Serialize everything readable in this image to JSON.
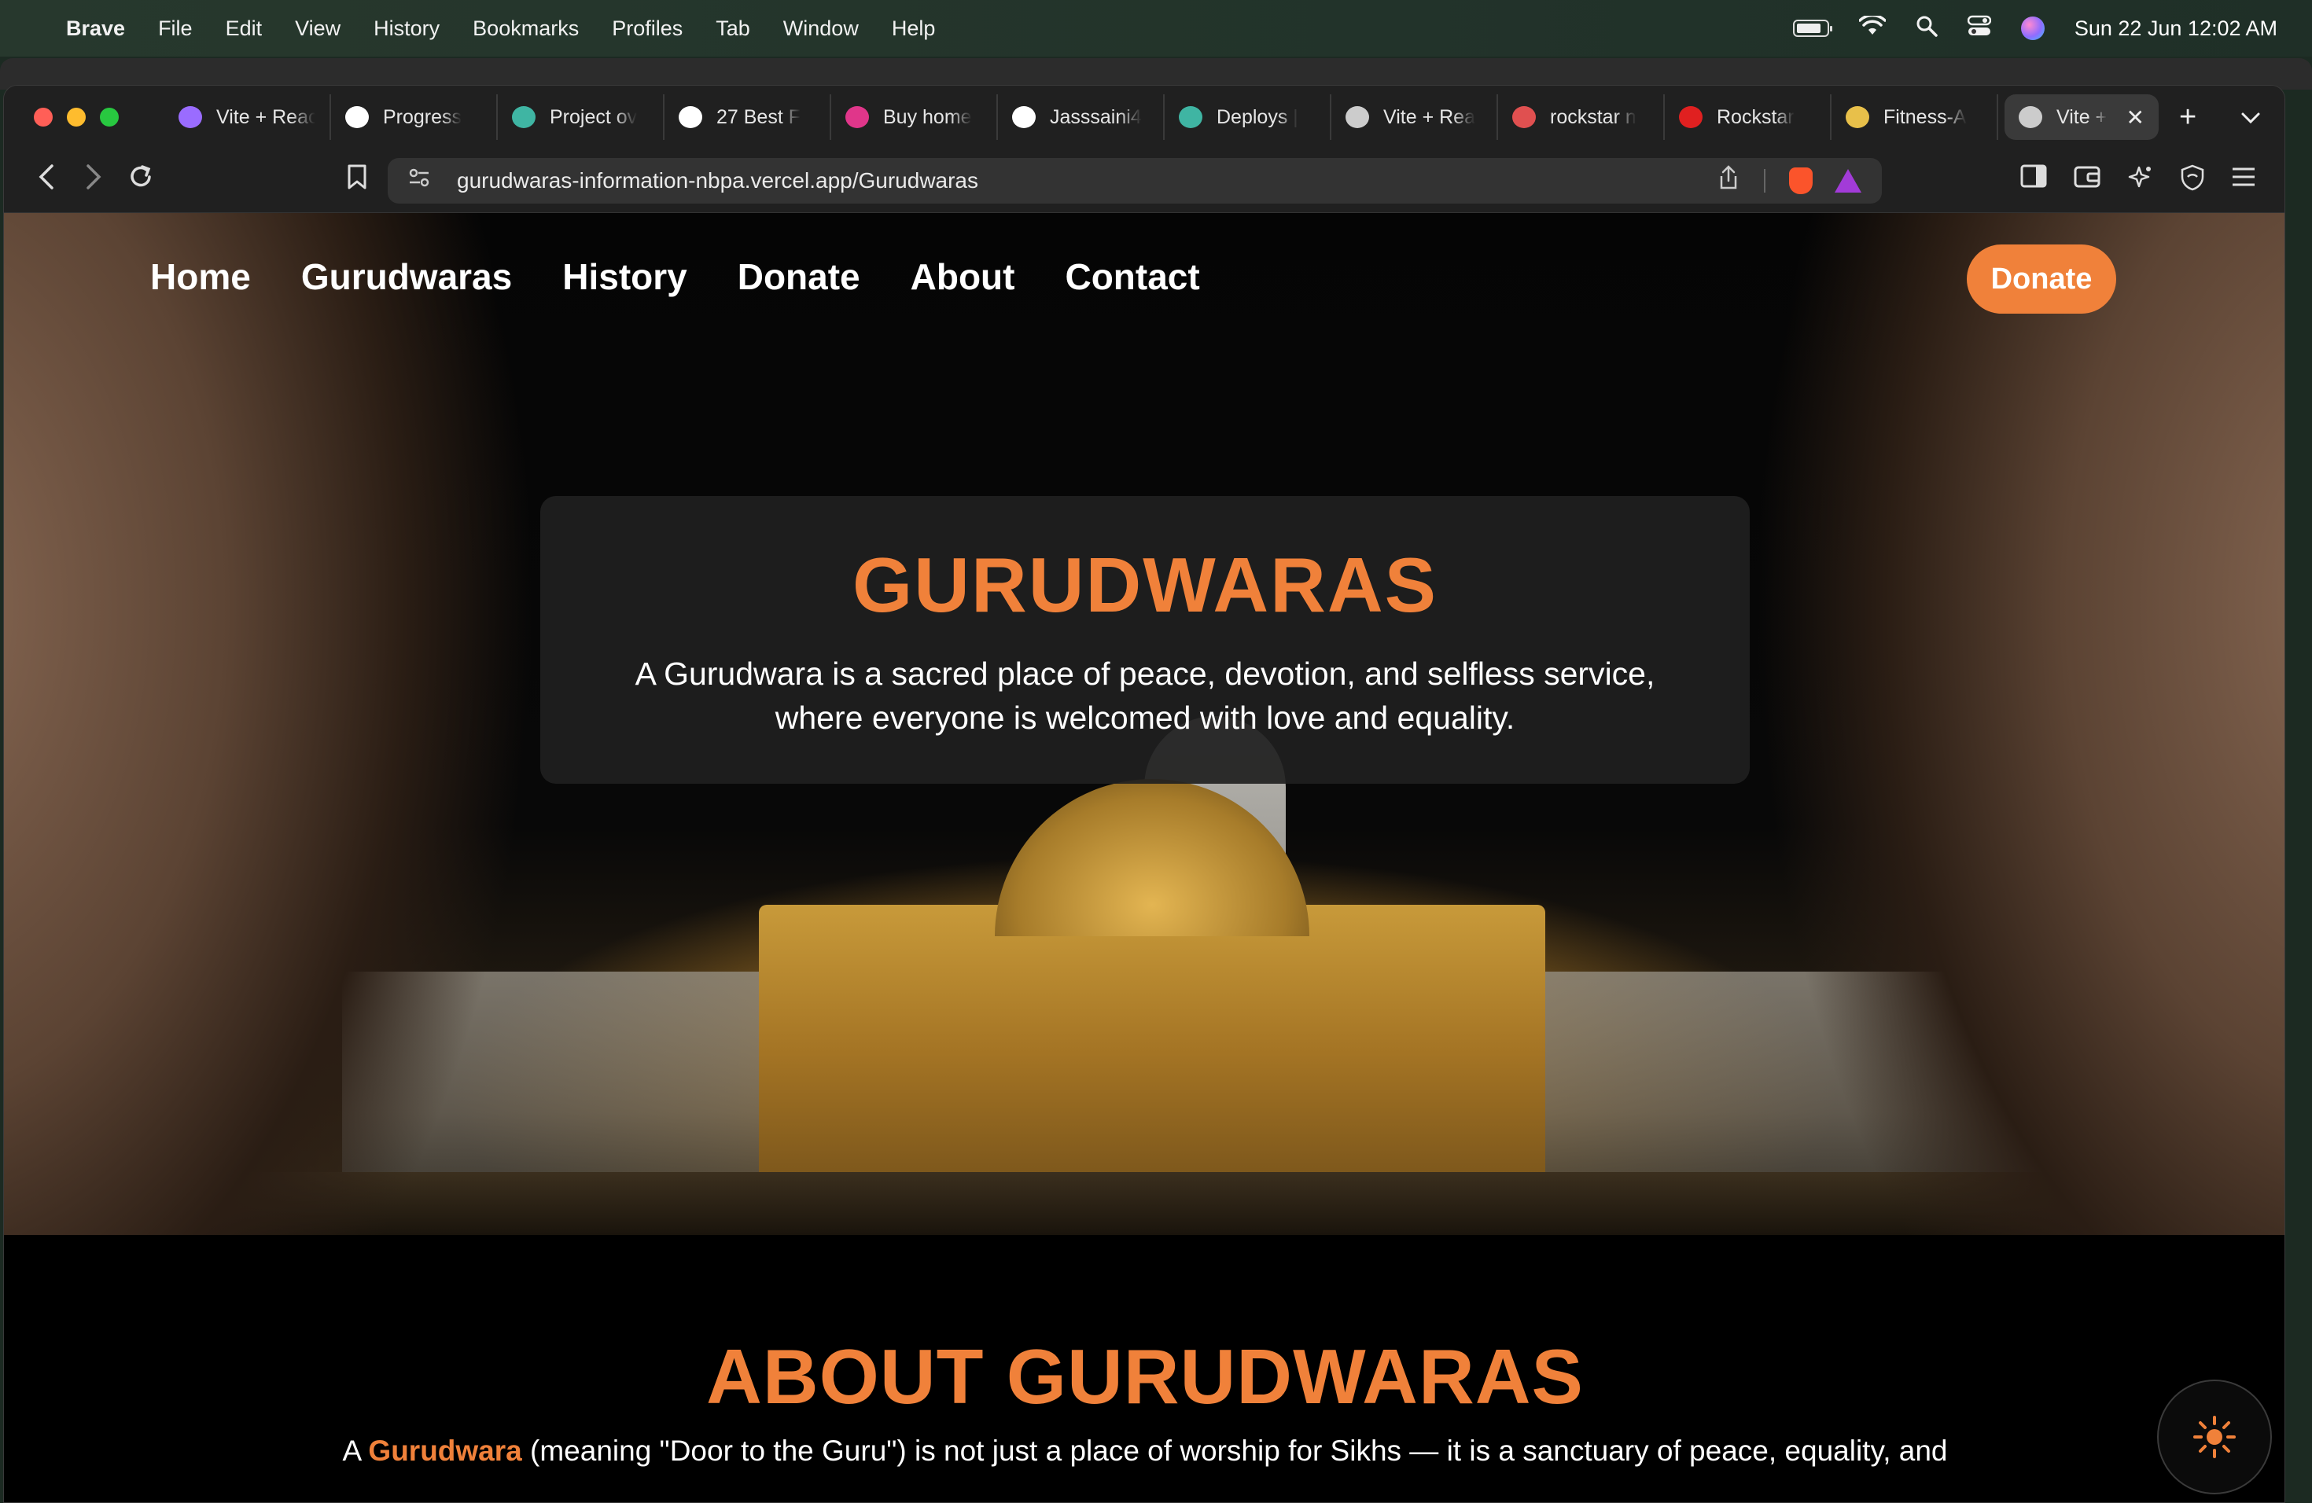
{
  "menubar": {
    "app": "Brave",
    "items": [
      "File",
      "Edit",
      "View",
      "History",
      "Bookmarks",
      "Profiles",
      "Tab",
      "Window",
      "Help"
    ],
    "clock": "Sun 22 Jun  12:02 AM"
  },
  "tabs": [
    {
      "title": "Vite + React",
      "icon": "vite-icon",
      "icon_color": "#9a6cff"
    },
    {
      "title": "Progress",
      "icon": "openai-icon",
      "icon_color": "#ffffff"
    },
    {
      "title": "Project ov",
      "icon": "netlify-icon",
      "icon_color": "#3fb5a3"
    },
    {
      "title": "27 Best F",
      "icon": "upwork-icon",
      "icon_color": "#ffffff"
    },
    {
      "title": "Buy home",
      "icon": "m-icon",
      "icon_color": "#e0368a"
    },
    {
      "title": "Jasssaini4",
      "icon": "github-icon",
      "icon_color": "#ffffff"
    },
    {
      "title": "Deploys |",
      "icon": "netlify-icon",
      "icon_color": "#3fb5a3"
    },
    {
      "title": "Vite + Rea",
      "icon": "globe-icon",
      "icon_color": "#cccccc"
    },
    {
      "title": "rockstar n",
      "icon": "shield-icon",
      "icon_color": "#e05050"
    },
    {
      "title": "Rockstar",
      "icon": "rockstar-icon",
      "icon_color": "#e02020"
    },
    {
      "title": "Fitness-A",
      "icon": "fitness-icon",
      "icon_color": "#e8c04a"
    },
    {
      "title": "Vite +",
      "icon": "globe-icon",
      "icon_color": "#cccccc",
      "active": true
    }
  ],
  "toolbar": {
    "url": "gurudwaras-information-nbpa.vercel.app/Gurudwaras"
  },
  "site": {
    "nav": [
      "Home",
      "Gurudwaras",
      "History",
      "Donate",
      "About",
      "Contact"
    ],
    "donate_button": "Donate",
    "hero_title": "GURUDWARAS",
    "hero_text": "A Gurudwara is a sacred place of peace, devotion, and selfless service, where everyone is welcomed with love and equality.",
    "about_title": "ABOUT GURUDWARAS",
    "about_prefix": "A ",
    "about_highlight": "Gurudwara",
    "about_rest": " (meaning \"Door to the Guru\") is not just a place of worship for Sikhs — it is a sanctuary of peace, equality, and"
  },
  "colors": {
    "accent": "#f0813a",
    "card_bg": "#202020"
  }
}
